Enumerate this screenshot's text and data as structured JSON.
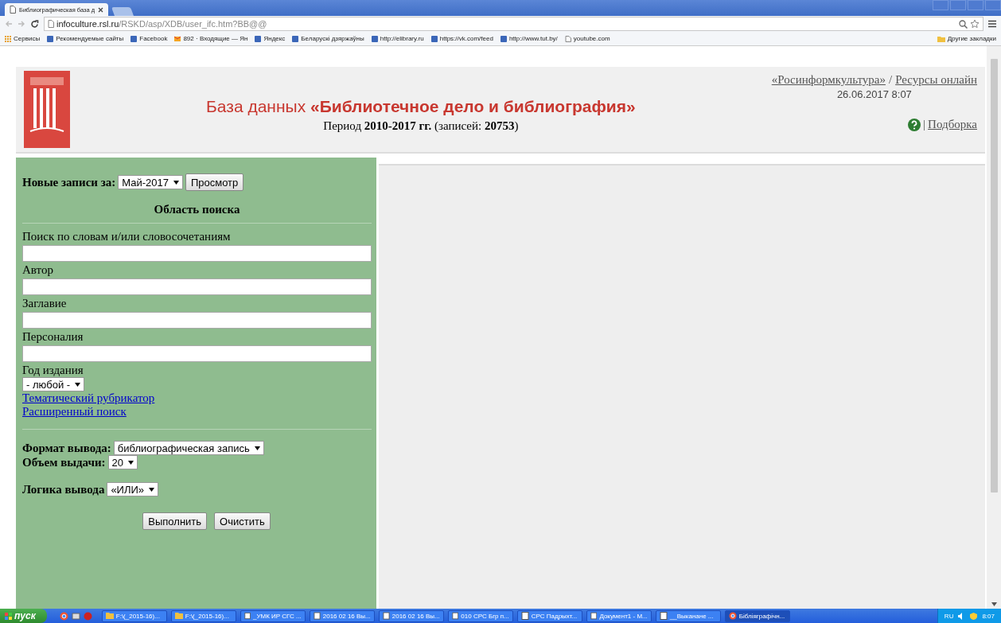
{
  "browser": {
    "tabs": [
      {
        "title": "Библиографическая база д",
        "selected": true
      }
    ],
    "address": {
      "host": "infoculture.rsl.ru",
      "path": "/RSKD/asp/XDB/user_ifc.htm?BB@@"
    },
    "bookmarks": [
      {
        "label": "Сервисы",
        "kind": "apps"
      },
      {
        "label": "Рекомендуемые сайты",
        "kind": "site"
      },
      {
        "label": "Facebook",
        "kind": "site"
      },
      {
        "label": "892 · Входящие — Ян",
        "kind": "mail"
      },
      {
        "label": "Яндекс",
        "kind": "site"
      },
      {
        "label": "Беларускі дзяржаўны",
        "kind": "site"
      },
      {
        "label": "http://elibrary.ru",
        "kind": "site"
      },
      {
        "label": "https://vk.com/feed",
        "kind": "site"
      },
      {
        "label": "http://www.tut.by/",
        "kind": "site"
      },
      {
        "label": "youtube.com",
        "kind": "page"
      }
    ],
    "other_bookmarks": "Другие закладки"
  },
  "header": {
    "title": "База данных **«Библиотечное дело и библиография»**",
    "period": "Период **2010-2017 гг.** (записей: **20753**)",
    "links": [
      "«Росинформкультура»",
      "Ресурсы онлайн"
    ],
    "link_separator": "/",
    "date": "26.06.2017 8:07",
    "selection_separator": "|",
    "selection_link": "Подборка"
  },
  "form": {
    "new_records": {
      "label": "Новые записи за:",
      "value": "Май-2017",
      "button": "Просмотр"
    },
    "section_title": "Область поиска",
    "fields": [
      {
        "label": "Поиск по словам и/или словосочетаниям"
      },
      {
        "label": "Автор"
      },
      {
        "label": "Заглавие"
      },
      {
        "label": "Персоналия"
      }
    ],
    "year": {
      "label": "Год издания",
      "value": "- любой -"
    },
    "links": [
      "Тематический рубрикатор",
      "Расширенный поиск"
    ],
    "output_format": {
      "label": "Формат вывода:",
      "value": "библиографическая запись"
    },
    "output_count": {
      "label": "Объем выдачи:",
      "value": "20"
    },
    "output_logic": {
      "label": "Логика вывода",
      "value": "«ИЛИ»"
    },
    "buttons": [
      "Выполнить",
      "Очистить"
    ]
  },
  "taskbar": {
    "start": "пуск",
    "items": [
      {
        "label": "F:\\(_2015-16)...",
        "kind": "folder",
        "selected": false
      },
      {
        "label": "F:\\(_2015-16)...",
        "kind": "folder",
        "selected": false
      },
      {
        "label": "_УМК ИР СГС ...",
        "kind": "doc",
        "selected": false
      },
      {
        "label": "2016 02 16 Вы...",
        "kind": "doc",
        "selected": false
      },
      {
        "label": "2016 02 16 Вы...",
        "kind": "doc",
        "selected": false
      },
      {
        "label": "010 СРС Бгр п...",
        "kind": "doc",
        "selected": false
      },
      {
        "label": "СРС Падрыхт...",
        "kind": "doc",
        "selected": false
      },
      {
        "label": "Документ1 - М...",
        "kind": "doc",
        "selected": false
      },
      {
        "label": "__Выканане ...",
        "kind": "doc",
        "selected": false
      },
      {
        "label": "Бібліяграфічн...",
        "kind": "browser",
        "selected": true
      }
    ],
    "language": "RU",
    "clock": "8:07"
  }
}
